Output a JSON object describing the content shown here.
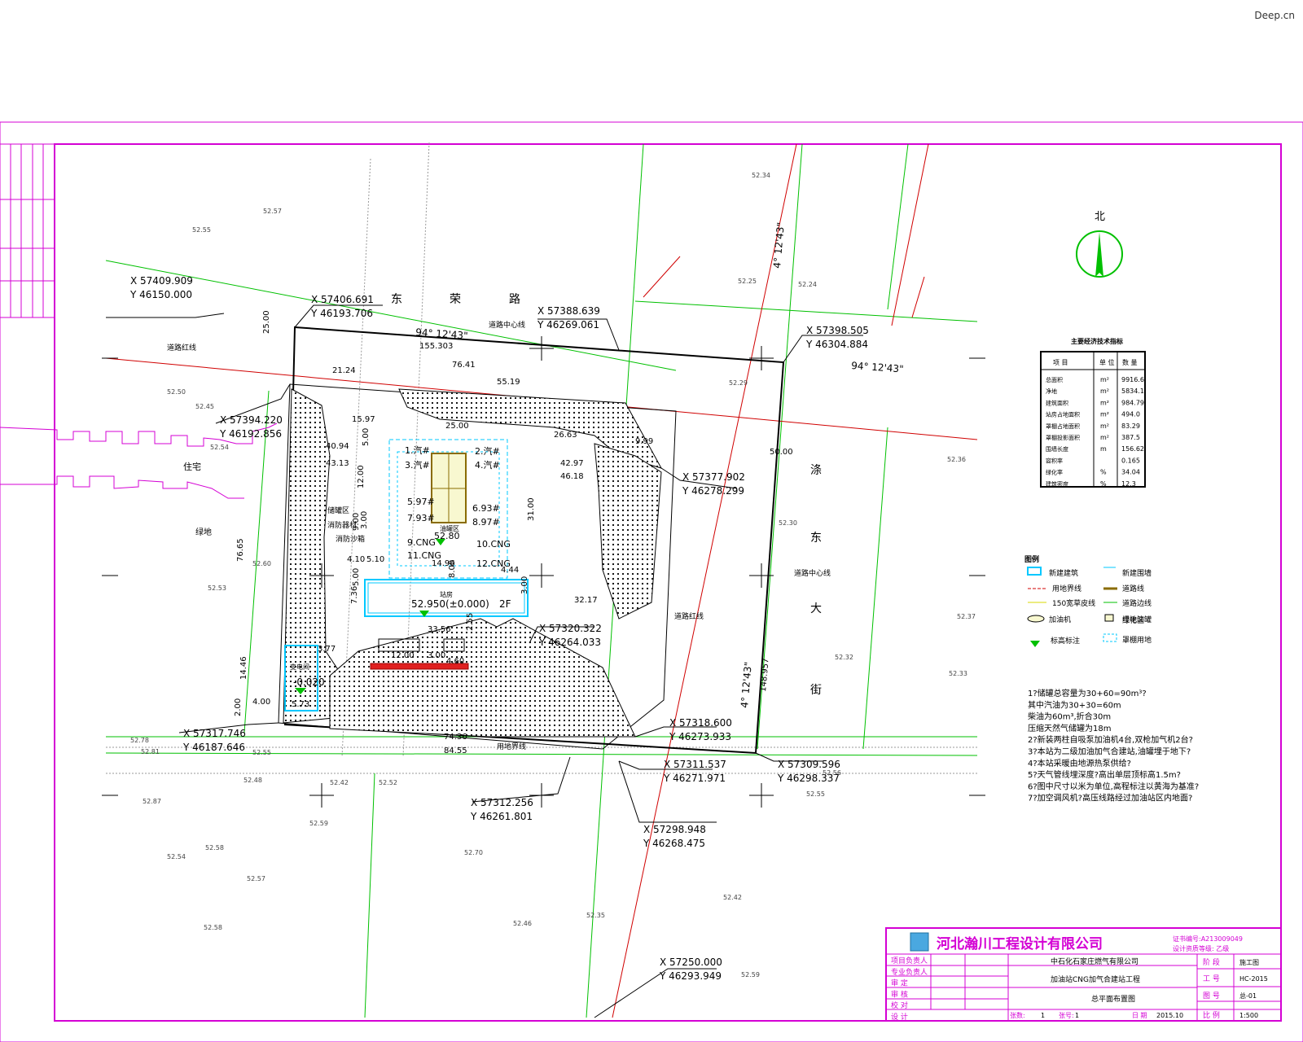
{
  "watermark": "Deep.cn",
  "colors": {
    "frame": "#d400d4",
    "parcel": "#000000",
    "road": "#00c000",
    "redline": "#d00000",
    "grid": "#888888"
  },
  "north_label": "北",
  "street_names": {
    "north": [
      "东",
      "荣",
      "路"
    ],
    "east": [
      "涤",
      "东",
      "大",
      "街"
    ]
  },
  "coords": [
    {
      "x": "X 57409.909",
      "y": "Y 46150.000"
    },
    {
      "x": "X 57406.691",
      "y": "Y 46193.706"
    },
    {
      "x": "X 57388.639",
      "y": "Y 46269.061"
    },
    {
      "x": "X 57398.505",
      "y": "Y 46304.884"
    },
    {
      "x": "X 57394.220",
      "y": "Y 46192.856"
    },
    {
      "x": "X 57377.902",
      "y": "Y 46278.299"
    },
    {
      "x": "X 57320.322",
      "y": "Y 46264.033"
    },
    {
      "x": "X 57317.746",
      "y": "Y 46187.646"
    },
    {
      "x": "X 57318.600",
      "y": "Y 46273.933"
    },
    {
      "x": "X 57311.537",
      "y": "Y 46271.971"
    },
    {
      "x": "X 57309.596",
      "y": "Y 46298.337"
    },
    {
      "x": "X 57312.256",
      "y": "Y 46261.801"
    },
    {
      "x": "X 57298.948",
      "y": "Y 46268.475"
    },
    {
      "x": "X 57250.000",
      "y": "Y 46293.949"
    }
  ],
  "angles": [
    "94° 12'43\"",
    "94° 12'43\"",
    "4° 12'43\"",
    "4° 12'43\""
  ],
  "dims": [
    "155.303",
    "76.41",
    "55.19",
    "21.24",
    "25.00",
    "42.97",
    "46.18",
    "50.00",
    "26.63",
    "9.99",
    "40.94",
    "43.13",
    "15.97",
    "5.00",
    "12.00",
    "9.00",
    "31.00",
    "76.65",
    "14.46",
    "4.00",
    "2.00",
    "5.73",
    "3.77",
    "74.36",
    "84.55",
    "148.957",
    "25.00",
    "32.17",
    "7.36",
    "3.00",
    "3.00",
    "5.00",
    "33.56",
    "12.00",
    "3.00",
    "4.60",
    "2.55",
    "4.10",
    "5.10",
    "14.96",
    "8.00",
    "4.44"
  ],
  "labels": {
    "road_centerline": "道路中心线",
    "red_line": "道路红线",
    "boundary": "用地界线",
    "station": "站房",
    "station_elev": "52.950(±0.000)",
    "floors": "2F",
    "canopy_elev": "52.80",
    "elev_left": "-0.020",
    "transformer": "变电间",
    "dispensers": [
      "1.汽#",
      "2.汽#",
      "3.汽#",
      "4.汽#",
      "5.97#",
      "6.93#",
      "7.93#",
      "8.97#",
      "9.CNG",
      "10.CNG",
      "11.CNG",
      "12.CNG"
    ],
    "tanks": "油罐区",
    "misc": [
      "储罐区",
      "消防器材",
      "消防沙箱"
    ],
    "left_zone": "住宅",
    "river": "绿地"
  },
  "spot_elevs": [
    "52.57",
    "52.55",
    "52.34",
    "52.25",
    "52.24",
    "52.50",
    "52.45",
    "52.54",
    "52.60",
    "52.53",
    "52.29",
    "52.30",
    "52.36",
    "52.37",
    "52.33",
    "52.32",
    "52.78",
    "52.81",
    "52.55",
    "52.48",
    "52.42",
    "52.52",
    "52.56",
    "52.87",
    "52.59",
    "52.54",
    "52.57",
    "52.58",
    "52.70",
    "52.46",
    "52.35",
    "52.42",
    "52.58",
    "52.59",
    "52.55"
  ],
  "tech_table": {
    "title": "主要经济技术指标",
    "header": [
      "项  目",
      "单 位",
      "数 量"
    ],
    "rows": [
      [
        "总面积",
        "m²",
        "9916.6"
      ],
      [
        "净地",
        "m²",
        "5834.1"
      ],
      [
        "建筑面积",
        "m²",
        "984.79"
      ],
      [
        "站房占地面积",
        "m²",
        "494.0"
      ],
      [
        "罩棚占地面积",
        "m²",
        "83.29"
      ],
      [
        "罩棚投影面积",
        "m²",
        "387.5"
      ],
      [
        "围墙长度",
        "m",
        "156.62"
      ],
      [
        "容积率",
        "",
        "0.165"
      ],
      [
        "绿化率",
        "%",
        "34.04"
      ],
      [
        "建筑密度",
        "%",
        "12.3"
      ]
    ]
  },
  "legend": {
    "title": "图例",
    "items": [
      "新建建筑",
      "新建围墙",
      "用地界线",
      "道路线",
      "150宽草皮线",
      "道路边线",
      "加油机",
      "埋地油罐",
      "标高标注",
      "绿化区",
      "罩棚用地"
    ]
  },
  "notes": [
    "1?储罐总容量为30+60=90m³?",
    "   其中汽油为30+30=60m",
    "   柴油为60m³,折合30m",
    "   压缩天然气储罐为18m",
    "2?新装两柱自吸泵加油机4台,双枪加气机2台?",
    "3?本站为二级加油加气合建站,油罐埋于地下?",
    "4?本站采暖由地源热泵供给?",
    "5?天气管线埋深度?高出单层顶标高1.5m?",
    "6?图中尺寸以米为单位,高程标注以黄海为基准?",
    "7?加空调风机?高压线路经过加油站区内地面?"
  ],
  "title_block": {
    "company": "河北瀚川工程设计有限公司",
    "cert": "证书编号:A213009049",
    "cert2": "设计资质等级: 乙级",
    "rows": [
      "项目负责人",
      "专业负责人",
      "审  定",
      "审  核",
      "校  对",
      "设  计"
    ],
    "project": "中石化石家庄燃气有限公司",
    "project2": "加油站CNG加气合建站工程",
    "drawing": "总平面布置图",
    "fields": [
      "阶  段",
      "工  号",
      "图  号",
      "比  例"
    ],
    "values": [
      "施工图",
      "HC-2015",
      "总-01",
      "1:500"
    ],
    "bottom": [
      "张数:",
      "1",
      "张号:",
      "1",
      "日  期",
      "2015.10"
    ]
  }
}
